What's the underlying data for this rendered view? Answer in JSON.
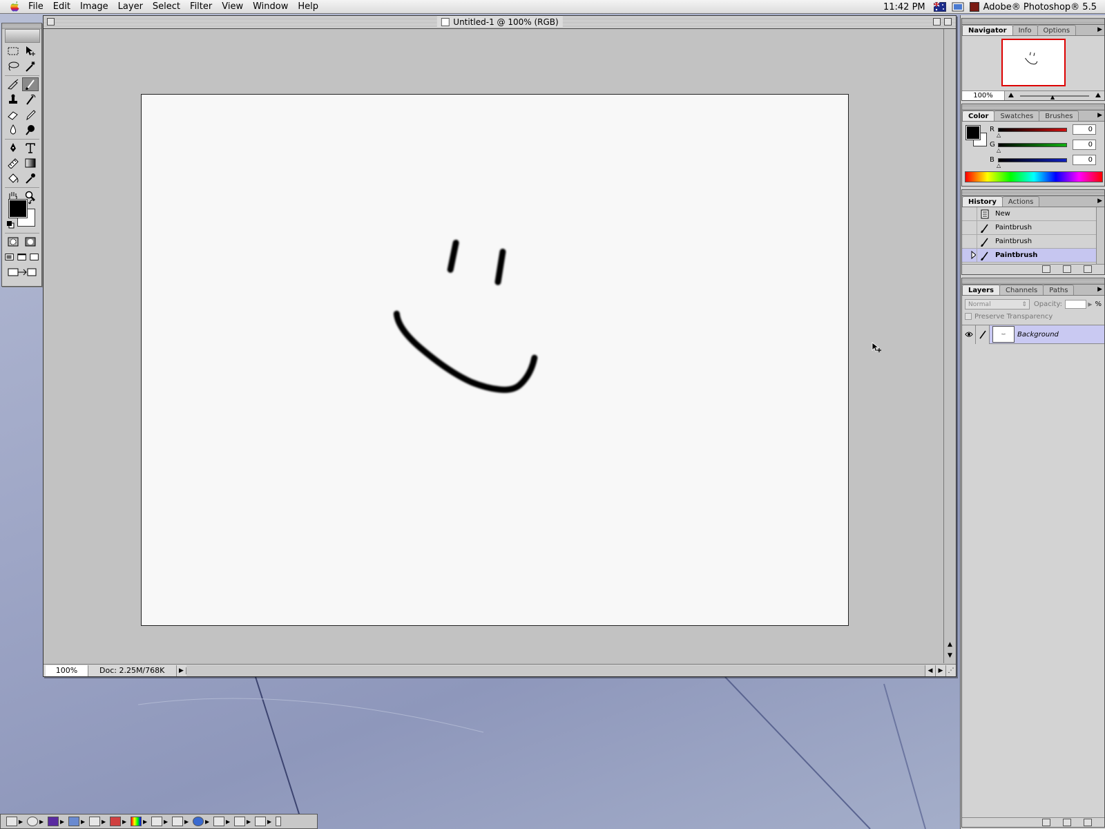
{
  "menubar": {
    "apple_icon": "apple-logo-icon",
    "items": [
      "File",
      "Edit",
      "Image",
      "Layer",
      "Select",
      "Filter",
      "View",
      "Window",
      "Help"
    ],
    "clock": "11:42 PM",
    "app_name": "Adobe® Photoshop® 5.5"
  },
  "document": {
    "title": "Untitled-1 @ 100% (RGB)",
    "zoom": "100%",
    "doc_size": "Doc: 2.25M/768K"
  },
  "navigator": {
    "tabs": [
      "Navigator",
      "Info",
      "Options"
    ],
    "zoom": "100%"
  },
  "color": {
    "tabs": [
      "Color",
      "Swatches",
      "Brushes"
    ],
    "channels": [
      {
        "label": "R",
        "value": "0",
        "color": "#d01010"
      },
      {
        "label": "G",
        "value": "0",
        "color": "#10b010"
      },
      {
        "label": "B",
        "value": "0",
        "color": "#1020c0"
      }
    ]
  },
  "history": {
    "tabs": [
      "History",
      "Actions"
    ],
    "items": [
      "New",
      "Paintbrush",
      "Paintbrush",
      "Paintbrush"
    ]
  },
  "layers": {
    "tabs": [
      "Layers",
      "Channels",
      "Paths"
    ],
    "blend_mode": "Normal",
    "opacity_label": "Opacity:",
    "opacity_unit": "%",
    "preserve_transparency": "Preserve Transparency",
    "layer_name": "Background"
  },
  "colors": {
    "desktop": "#9ea6c6",
    "selection": "#c6c6f0"
  }
}
